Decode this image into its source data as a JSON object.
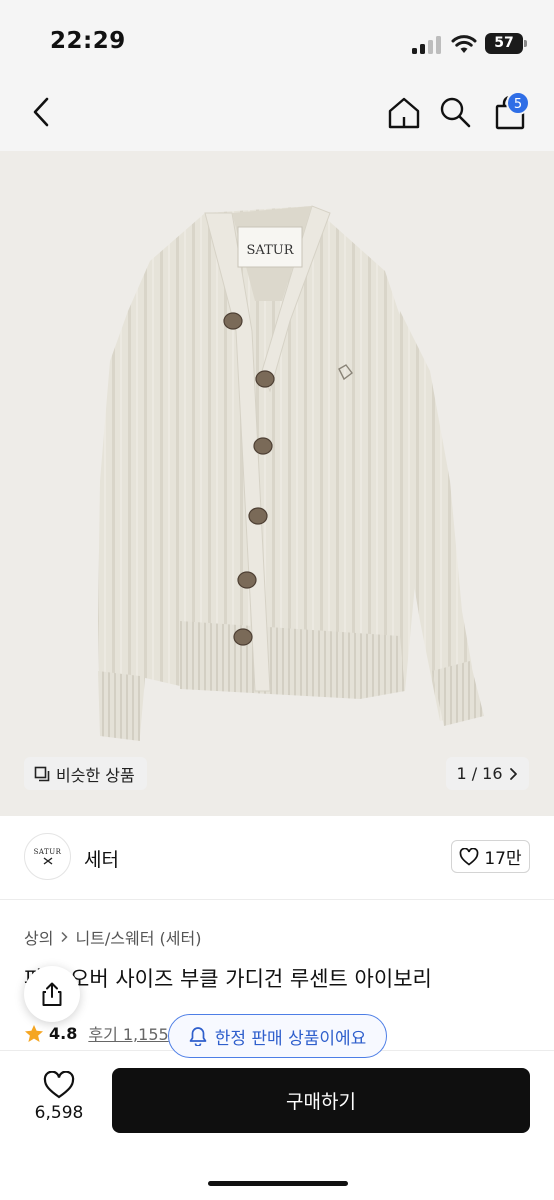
{
  "status_bar": {
    "time": "22:29",
    "battery": "57"
  },
  "nav": {
    "back_icon": "chevron-left-icon",
    "home_icon": "home-icon",
    "search_icon": "search-icon",
    "bag_icon": "shopping-bag-icon",
    "cart_badge": "5"
  },
  "product_image": {
    "label_text": "SATUR",
    "similar_button": "비슷한 상품",
    "page_counter": "1 / 16"
  },
  "brand": {
    "logo_text": "SATUR",
    "name": "세터",
    "likes": "17만"
  },
  "info": {
    "breadcrumb": [
      "상의",
      "니트/스웨터 (세터)"
    ],
    "title": "파... 오버 사이즈 부클 가디건 루센트 아이보리",
    "rating": "4.8",
    "reviews": "후기 1,155"
  },
  "limited_notice": "한정 판매 상품이에요",
  "bottom": {
    "wish_count": "6,598",
    "buy_label": "구매하기"
  },
  "colors": {
    "accent_blue": "#2f6ee6",
    "star": "#f5a623",
    "cardigan": "#e6e3d9",
    "buy_button": "#0f0f0f"
  }
}
